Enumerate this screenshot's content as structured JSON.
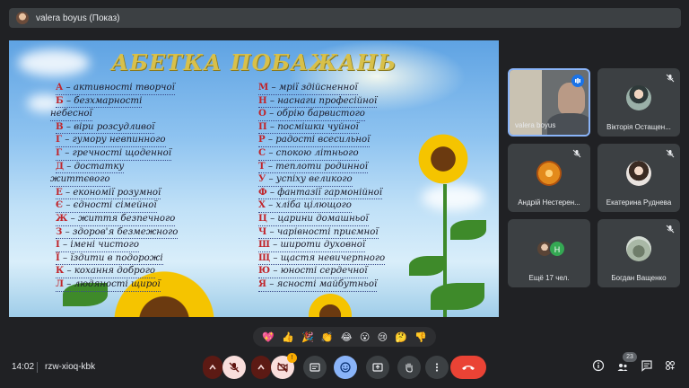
{
  "header": {
    "presenter_title": "valera boyus (Показ)"
  },
  "slide": {
    "heading": "АБЕТКА ПОБАЖАНЬ",
    "left_column": [
      {
        "letter": "А",
        "text": " – активності творчої"
      },
      {
        "letter": "Б",
        "text": " – безхмарності"
      },
      {
        "letter": "",
        "text": "небесної"
      },
      {
        "letter": "В",
        "text": " – віри розсудливої"
      },
      {
        "letter": "Г",
        "text": " – гумору невпинного"
      },
      {
        "letter": "Г",
        "text": " – гречності щоденної"
      },
      {
        "letter": "Д",
        "text": " – достатку"
      },
      {
        "letter": "",
        "text": "життєвого"
      },
      {
        "letter": "Е",
        "text": " – економії розумної"
      },
      {
        "letter": "Є",
        "text": " – єдності сімейної"
      },
      {
        "letter": "Ж",
        "text": " – життя безпечного"
      },
      {
        "letter": "З",
        "text": " – здоров'я безмежного"
      },
      {
        "letter": "І",
        "text": " – імені чистого"
      },
      {
        "letter": "Ї",
        "text": " – їздити в подорожі"
      },
      {
        "letter": "К",
        "text": " – кохання доброго"
      },
      {
        "letter": "Л",
        "text": " – людяності щирої"
      }
    ],
    "right_column": [
      {
        "letter": "М",
        "text": " – мрії здійсненної"
      },
      {
        "letter": "Н",
        "text": " – наснаги професійної"
      },
      {
        "letter": "О",
        "text": " – обрію барвистого"
      },
      {
        "letter": "П",
        "text": " – посмішки чуйної"
      },
      {
        "letter": "Р",
        "text": " – радості всесильної"
      },
      {
        "letter": "С",
        "text": " – спокою літнього"
      },
      {
        "letter": "Т",
        "text": " – теплоти родинної"
      },
      {
        "letter": "У",
        "text": " – успіху великого"
      },
      {
        "letter": "Ф",
        "text": " – фантазії гармонійної"
      },
      {
        "letter": "Х",
        "text": " – хліба цілющого"
      },
      {
        "letter": "Ц",
        "text": " – царини домашньої"
      },
      {
        "letter": "Ч",
        "text": " – чарівності приємної"
      },
      {
        "letter": "Ш",
        "text": " – широти духовної"
      },
      {
        "letter": "Щ",
        "text": " – щастя невичерпного"
      },
      {
        "letter": "Ю",
        "text": " – юності сердечної"
      },
      {
        "letter": "Я",
        "text": " – ясності майбутньої"
      }
    ]
  },
  "participants": [
    {
      "name": "valera boyus",
      "speaking": true
    },
    {
      "name": "Вікторія Остащен...",
      "muted": true
    },
    {
      "name": "Андрій Нестерен...",
      "muted": true
    },
    {
      "name": "Екатерина Руднева",
      "muted": true
    },
    {
      "name": "Ещё 17 чел.",
      "extra_initial": "Н"
    },
    {
      "name": "Богдан Ващенко",
      "muted": true
    }
  ],
  "reactions": [
    "💖",
    "👍",
    "🎉",
    "👏",
    "😂",
    "😮",
    "😢",
    "🤔",
    "👎"
  ],
  "footer": {
    "time": "14:02",
    "meeting_code": "rzw-xioq-kbk",
    "camera_badge": "!",
    "people_count": "23"
  },
  "colors": {
    "accent": "#8ab4f8",
    "hangup": "#ea4335",
    "muted_bg": "#f9dedc"
  }
}
